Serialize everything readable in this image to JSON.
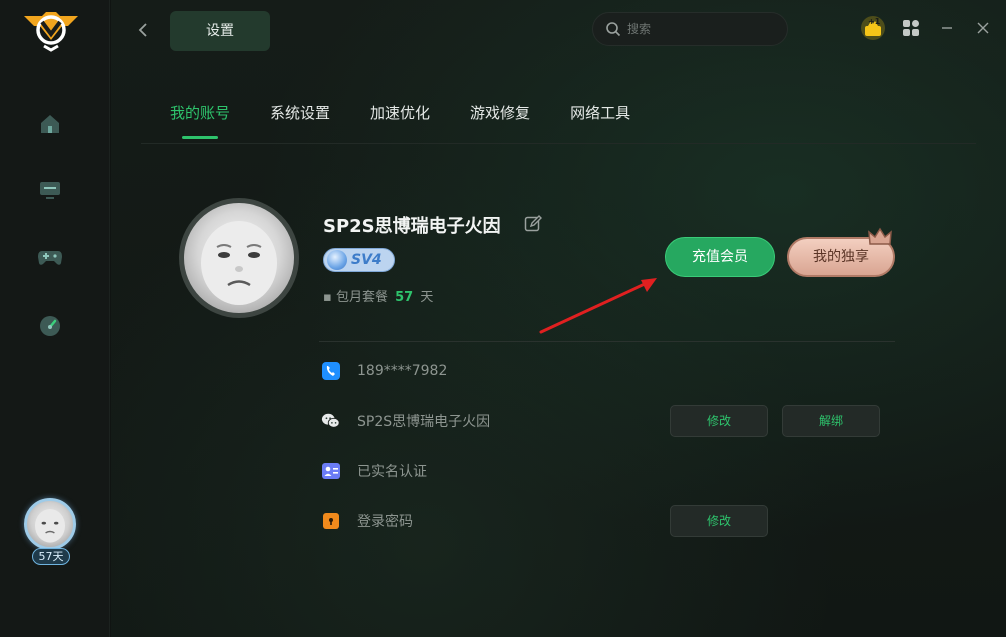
{
  "header": {
    "title": "设置",
    "search_placeholder": "搜索"
  },
  "sidebar": {
    "badge_days": "57天",
    "items": [
      {
        "icon": "home-icon"
      },
      {
        "icon": "monitor-icon"
      },
      {
        "icon": "gamepad-icon"
      },
      {
        "icon": "speedometer-icon"
      }
    ]
  },
  "tabs": [
    {
      "label": "我的账号",
      "active": true
    },
    {
      "label": "系统设置",
      "active": false
    },
    {
      "label": "加速优化",
      "active": false
    },
    {
      "label": "游戏修复",
      "active": false
    },
    {
      "label": "网络工具",
      "active": false
    }
  ],
  "profile": {
    "username": "SP2S思博瑞电子火因",
    "level": "SV4",
    "plan_label": "▪ 包月套餐",
    "plan_days": "57",
    "plan_unit": "天",
    "recharge_label": "充值会员",
    "exclusive_label": "我的独享"
  },
  "info": {
    "phone": "189****7982",
    "wechat": "SP2S思博瑞电子火因",
    "realname": "已实名认证",
    "password": "登录密码",
    "modify_label": "修改",
    "unbind_label": "解绑"
  },
  "colors": {
    "accent": "#2ec36c",
    "background": "#101412",
    "arrow": "#e02020"
  }
}
